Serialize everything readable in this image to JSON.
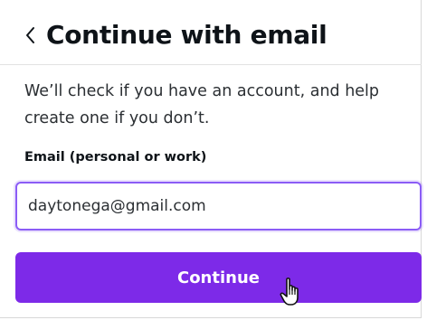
{
  "header": {
    "back_icon": "chevron-left-icon",
    "title": "Continue with email"
  },
  "description": "We’ll check if you have an account, and help create one if you don’t.",
  "email_field": {
    "label": "Email (personal or work)",
    "value": "daytonega@gmail.com"
  },
  "continue_button": {
    "label": "Continue"
  },
  "colors": {
    "accent": "#7d2ae8",
    "input_focus_border": "#8b5cf6",
    "text": "#0e1318"
  },
  "cursor": {
    "icon": "hand-pointer-icon"
  }
}
